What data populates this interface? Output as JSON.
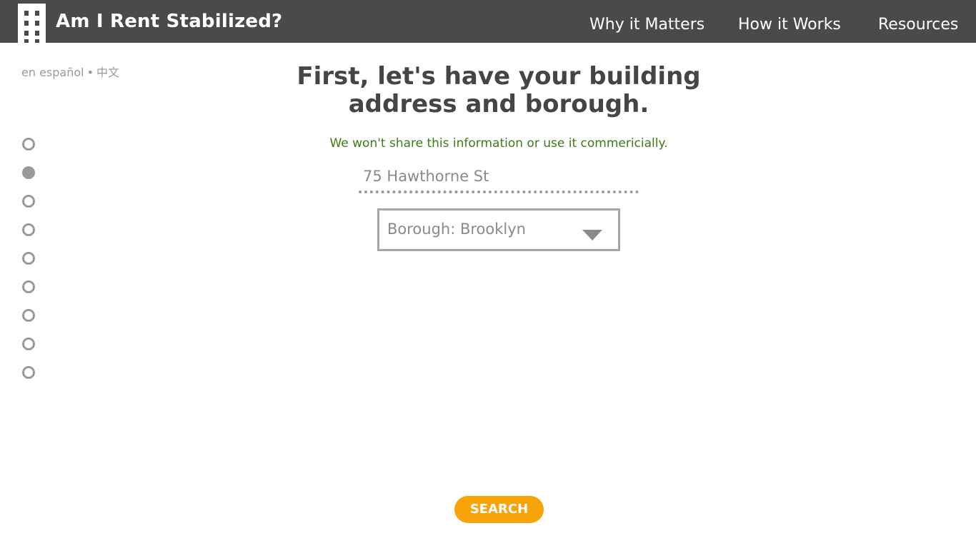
{
  "header": {
    "title": "Am I Rent Stabilized?",
    "logo_icon": "building-icon",
    "background_color": "#4a4a4a",
    "nav": [
      {
        "label": "Why it Matters"
      },
      {
        "label": "How it Works"
      },
      {
        "label": "Resources"
      }
    ]
  },
  "language": {
    "spanish": "en español",
    "separator": "•",
    "chinese": "中文"
  },
  "steps": {
    "total": 9,
    "current": 2
  },
  "form": {
    "headline": "First, let's have your building address and borough.",
    "privacy_note": "We won't share this information or use it commericially.",
    "address_value": "75 Hawthorne St",
    "borough_label": "Borough: Brooklyn",
    "dropdown_icon": "chevron-down-icon"
  },
  "actions": {
    "search_label": "SEARCH",
    "search_color": "#f7a30a"
  },
  "colors": {
    "privacy_note": "#3f7a17",
    "step_dot": "#9a9a9a"
  }
}
